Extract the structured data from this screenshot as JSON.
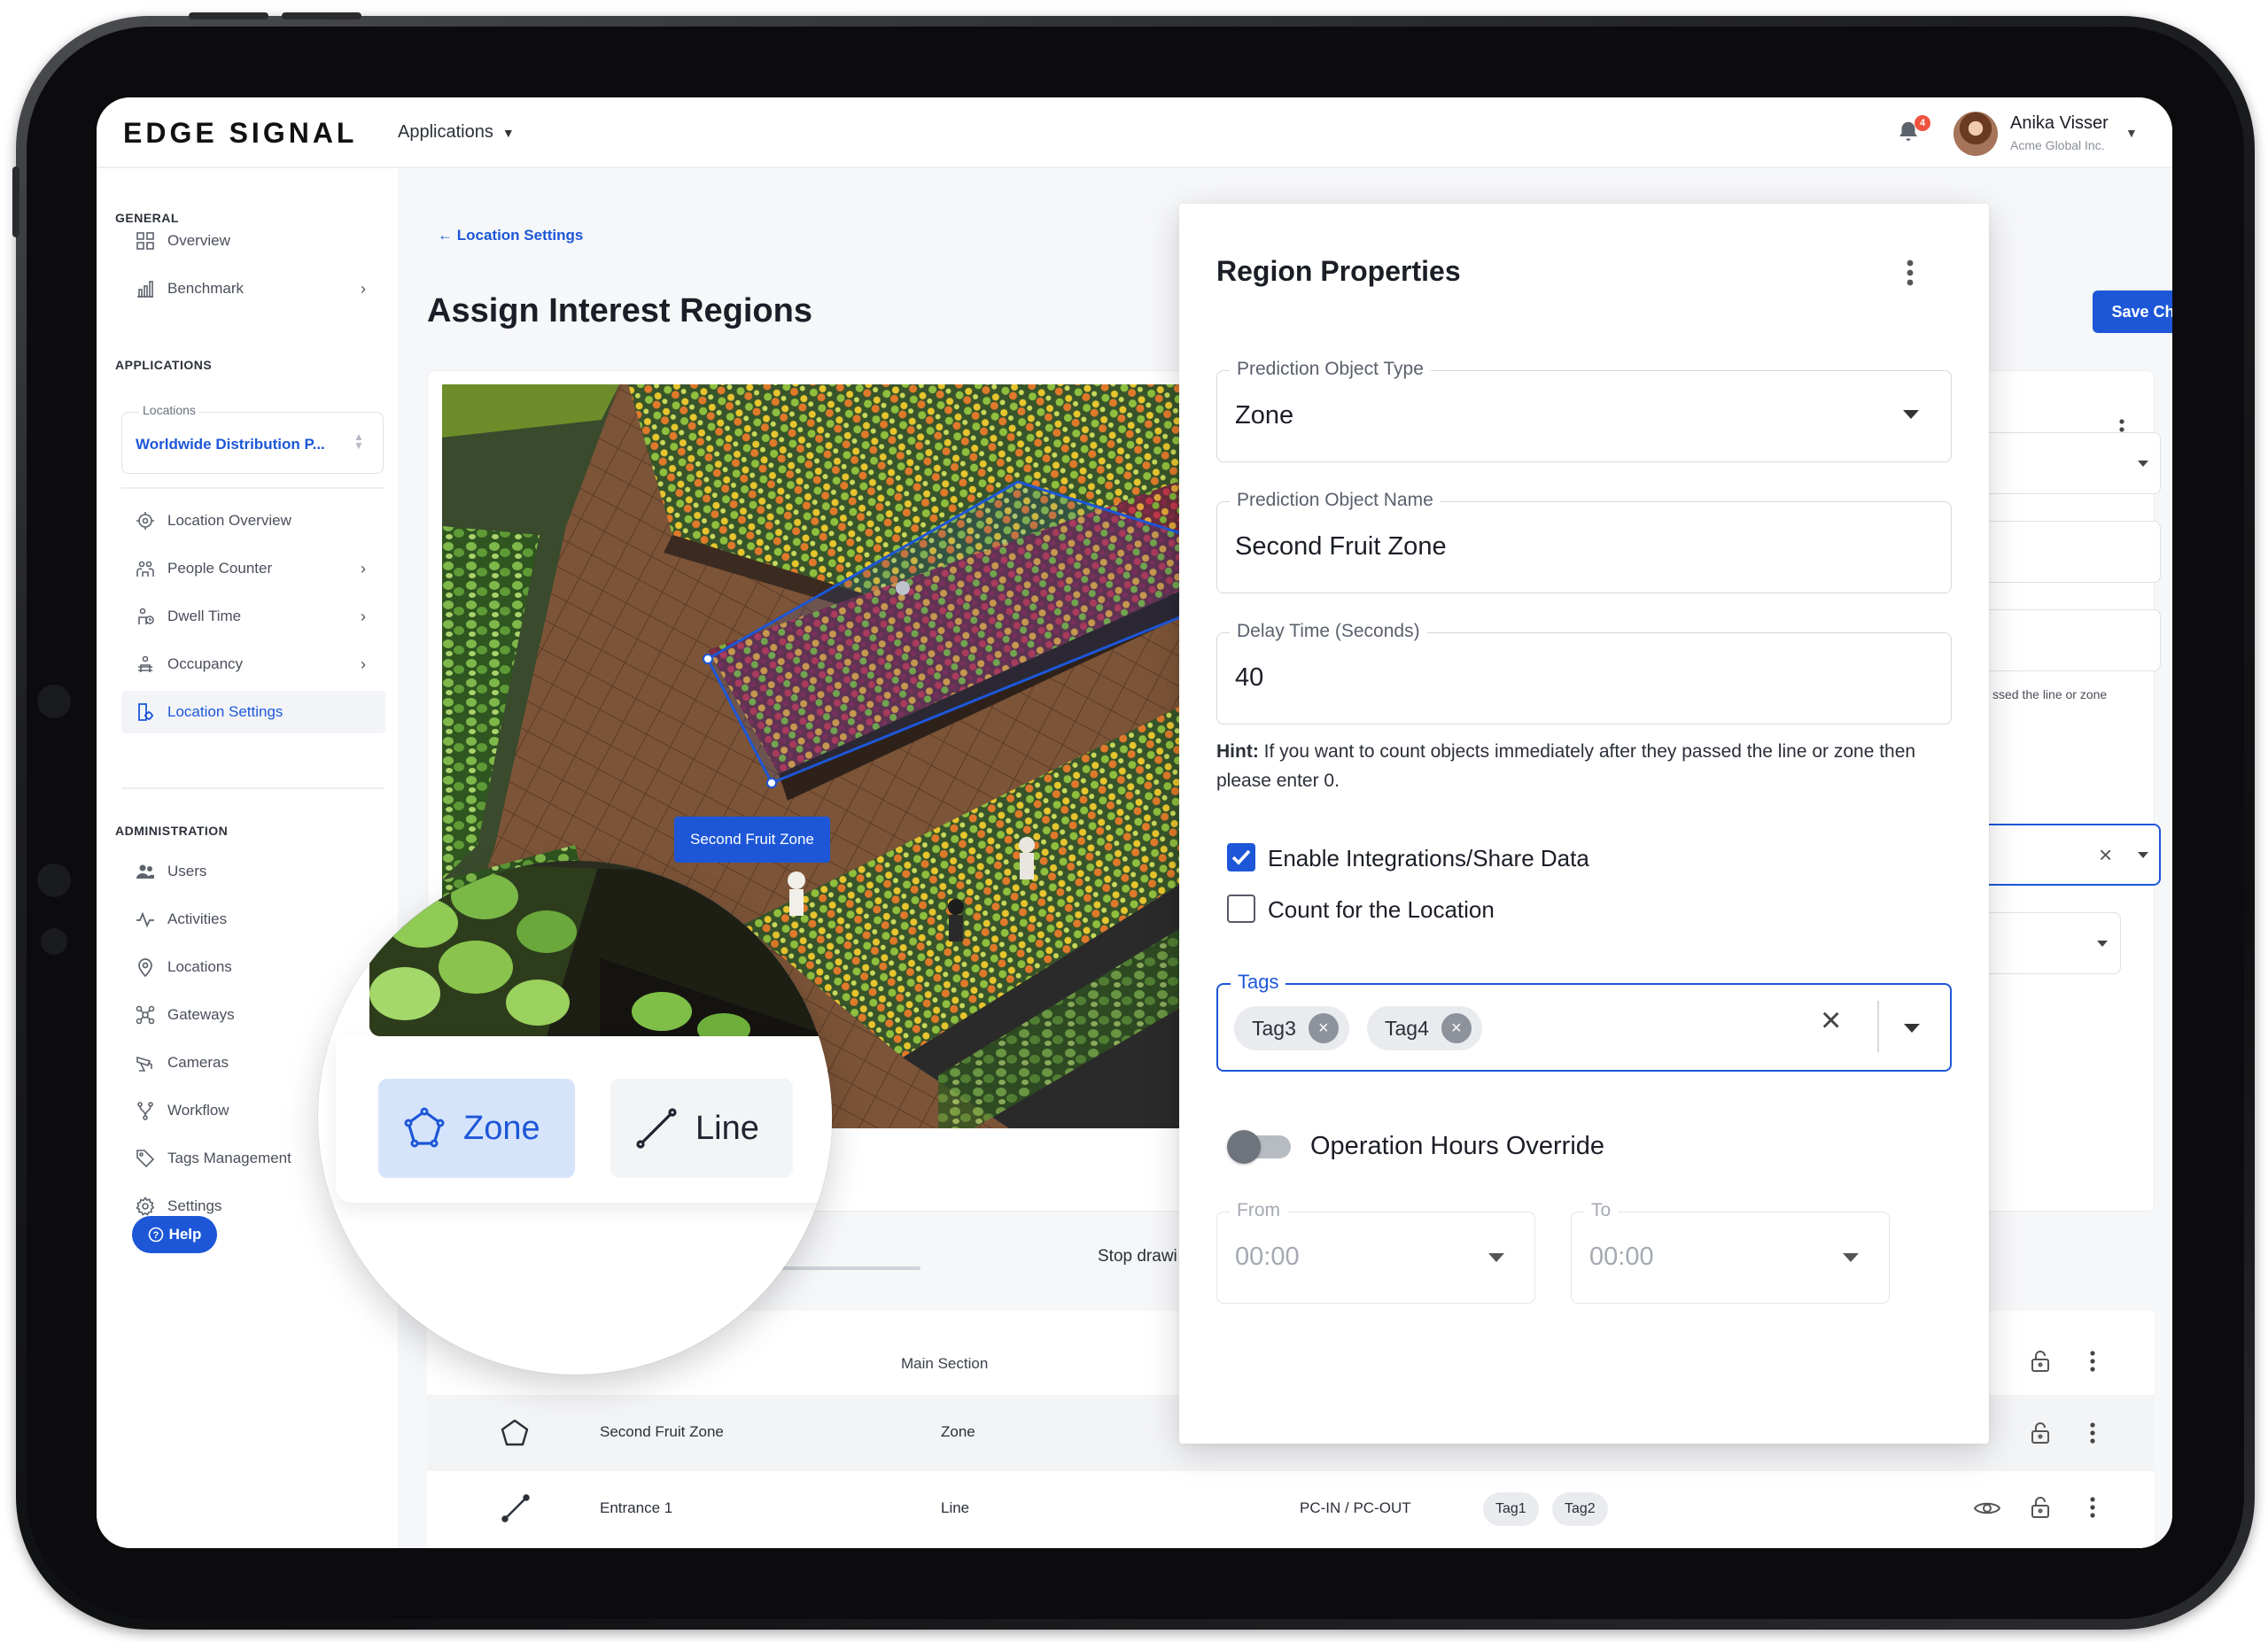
{
  "header": {
    "logo": "EDGE SIGNAL",
    "applications_label": "Applications",
    "notification_count": "4",
    "user_name": "Anika Visser",
    "user_org": "Acme Global Inc."
  },
  "sidebar": {
    "general_title": "GENERAL",
    "general_items": [
      {
        "label": "Overview",
        "icon": "grid-icon"
      },
      {
        "label": "Benchmark",
        "icon": "bar-chart-icon"
      }
    ],
    "applications_title": "APPLICATIONS",
    "locations_label": "Locations",
    "location_value": "Worldwide Distribution P...",
    "app_items": [
      {
        "label": "Location Overview",
        "icon": "target-icon"
      },
      {
        "label": "People Counter",
        "icon": "people-icon"
      },
      {
        "label": "Dwell Time",
        "icon": "dwell-icon"
      },
      {
        "label": "Occupancy",
        "icon": "occupancy-icon"
      },
      {
        "label": "Location Settings",
        "icon": "location-settings-icon",
        "active": true
      }
    ],
    "administration_title": "ADMINISTRATION",
    "admin_items": [
      {
        "label": "Users",
        "icon": "users-icon"
      },
      {
        "label": "Activities",
        "icon": "activity-icon"
      },
      {
        "label": "Locations",
        "icon": "map-pin-icon"
      },
      {
        "label": "Gateways",
        "icon": "gateway-icon"
      },
      {
        "label": "Cameras",
        "icon": "camera-icon"
      },
      {
        "label": "Workflow",
        "icon": "workflow-icon"
      },
      {
        "label": "Tags Management",
        "icon": "tag-icon"
      },
      {
        "label": "Settings",
        "icon": "gear-icon"
      }
    ],
    "help_label": "Help"
  },
  "main": {
    "back_label": "Location Settings",
    "title": "Assign Interest Regions",
    "save_label": "Save Changes",
    "zone_label": "Second Fruit Zone",
    "stop_drawing": "Stop drawi",
    "partial_hint": "ssed the line or zone",
    "mode_zone": "Zone",
    "mode_line": "Line"
  },
  "table": {
    "header_section": "Main Section",
    "rows": [
      {
        "name": "Second Fruit Zone",
        "type": "Zone",
        "section": "",
        "tags": []
      },
      {
        "name": "Entrance 1",
        "type": "Line",
        "section": "PC-IN / PC-OUT",
        "tags": [
          "Tag1",
          "Tag2"
        ]
      }
    ]
  },
  "panel": {
    "title": "Region Properties",
    "object_type_label": "Prediction Object Type",
    "object_type_value": "Zone",
    "object_name_label": "Prediction Object Name",
    "object_name_value": "Second Fruit Zone",
    "delay_label": "Delay Time (Seconds)",
    "delay_value": "40",
    "hint_bold": "Hint:",
    "hint_text": " If you want to count objects immediately after they passed the line or zone then please enter 0.",
    "enable_integrations_label": "Enable Integrations/Share Data",
    "enable_integrations_checked": true,
    "count_location_label": "Count for the Location",
    "count_location_checked": false,
    "tags_label": "Tags",
    "tags": [
      "Tag3",
      "Tag4"
    ],
    "override_label": "Operation Hours Override",
    "override_on": false,
    "from_label": "From",
    "from_value": "00:00",
    "to_label": "To",
    "to_value": "00:00"
  },
  "colors": {
    "accent": "#1d57d8",
    "badge": "#f0533f"
  }
}
